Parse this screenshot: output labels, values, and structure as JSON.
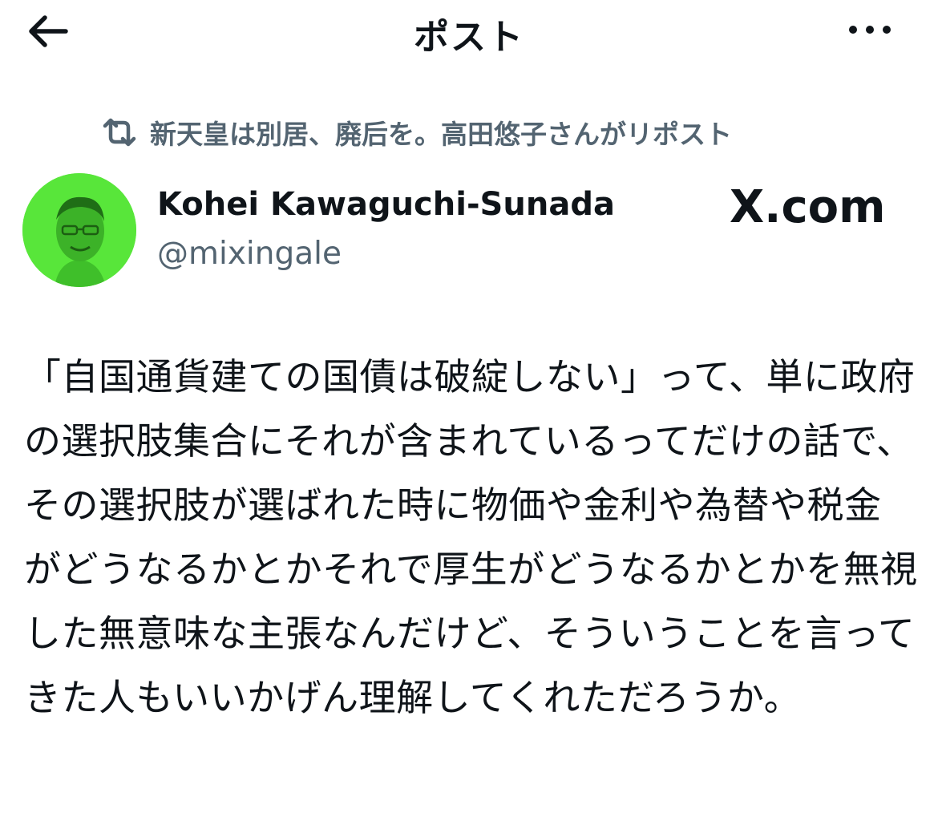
{
  "header": {
    "title": "ポスト"
  },
  "repost": {
    "text": "新天皇は別居、廃后を。高田悠子さんがリポスト"
  },
  "author": {
    "name": "Kohei Kawaguchi-Sunada",
    "handle": "@mixingale"
  },
  "watermark": "X.com",
  "post": {
    "text": "「自国通貨建ての国債は破綻しない」って、単に政府の選択肢集合にそれが含まれているってだけの話で、その選択肢が選ばれた時に物価や金利や為替や税金がどうなるかとかそれで厚生がどうなるかとかを無視した無意味な主張なんだけど、そういうことを言ってきた人もいいかげん理解してくれただろうか。"
  },
  "icons": {
    "back": "arrow-left-icon",
    "more": "more-horizontal-icon",
    "repost": "repost-icon"
  },
  "colors": {
    "text": "#0f1419",
    "muted": "#536471",
    "avatar_bg": "#58e63a"
  }
}
